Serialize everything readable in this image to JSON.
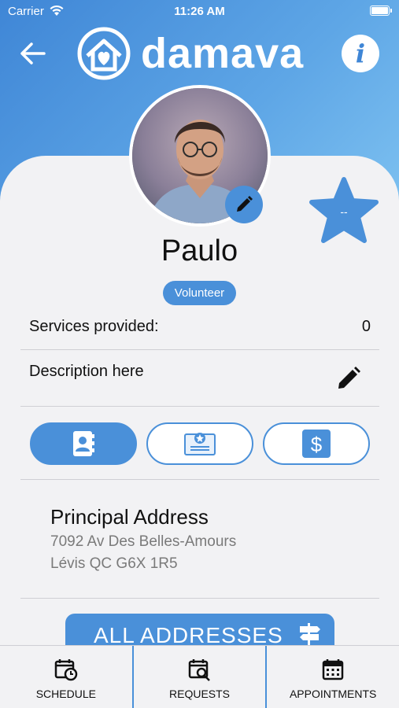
{
  "status_bar": {
    "carrier": "Carrier",
    "time": "11:26 AM"
  },
  "header": {
    "back_icon": "arrow-left-icon",
    "logo_text": "damava",
    "info_label": "i"
  },
  "profile": {
    "name": "Paulo",
    "role": "Volunteer",
    "rating_text": "--",
    "services_label": "Services provided:",
    "services_count": "0",
    "description": "Description here"
  },
  "tabs": [
    {
      "icon": "contact-book-icon",
      "active": true
    },
    {
      "icon": "certificate-icon",
      "active": false
    },
    {
      "icon": "dollar-icon",
      "active": false
    }
  ],
  "address": {
    "title": "Principal Address",
    "line1": "7092 Av Des Belles-Amours",
    "line2": "Lévis QC G6X 1R5"
  },
  "all_addresses_button": "ALL ADDRESSES",
  "bottom_nav": [
    {
      "label": "SCHEDULE",
      "icon": "calendar-clock-icon"
    },
    {
      "label": "REQUESTS",
      "icon": "calendar-search-icon"
    },
    {
      "label": "APPOINTMENTS",
      "icon": "calendar-icon"
    }
  ],
  "colors": {
    "primary": "#4a90d9",
    "card_bg": "#f2f2f4",
    "text": "#111111",
    "muted": "#7a7a7a"
  }
}
